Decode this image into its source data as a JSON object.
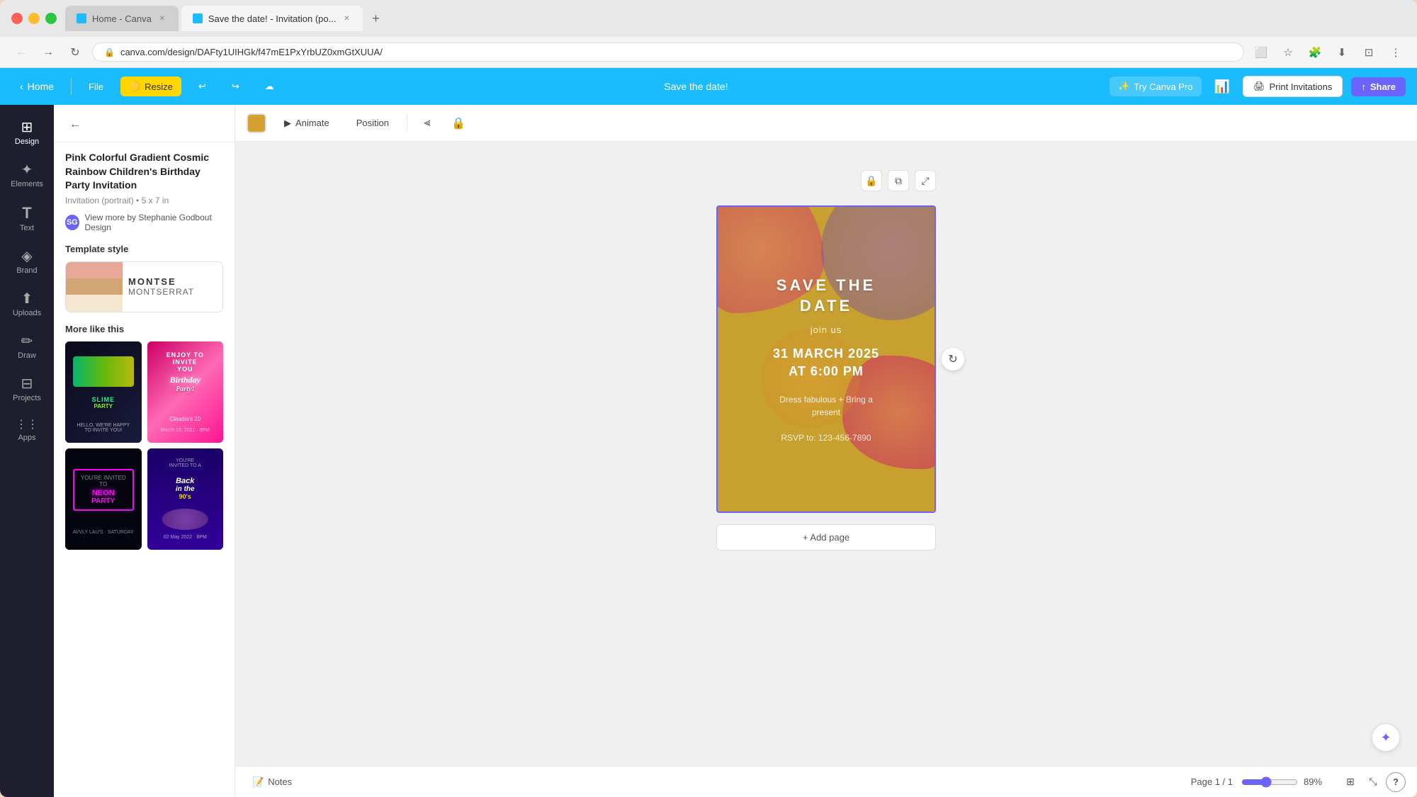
{
  "browser": {
    "tabs": [
      {
        "id": "home",
        "label": "Home - Canva",
        "active": false,
        "favicon": "C"
      },
      {
        "id": "design",
        "label": "Save the date! - Invitation (po...",
        "active": true,
        "favicon": "C"
      }
    ],
    "address": "canva.com/design/DAFty1UIHGk/f47mE1PxYrbUZ0xmGtXUUA/",
    "new_tab_label": "+"
  },
  "topbar": {
    "home_label": "Home",
    "file_label": "File",
    "resize_label": "Resize",
    "undo_icon": "↩",
    "redo_icon": "↪",
    "cloud_icon": "☁",
    "title": "Save the date!",
    "try_pro_label": "Try Canva Pro",
    "analytics_icon": "📊",
    "print_label": "Print Invitations",
    "share_label": "Share"
  },
  "icon_nav": {
    "items": [
      {
        "id": "design",
        "icon": "⊞",
        "label": "Design",
        "active": true
      },
      {
        "id": "elements",
        "icon": "✦",
        "label": "Elements"
      },
      {
        "id": "text",
        "icon": "T",
        "label": "Text"
      },
      {
        "id": "brand",
        "icon": "◈",
        "label": "Brand"
      },
      {
        "id": "uploads",
        "icon": "⬆",
        "label": "Uploads"
      },
      {
        "id": "draw",
        "icon": "✏",
        "label": "Draw"
      },
      {
        "id": "projects",
        "icon": "⊟",
        "label": "Projects"
      },
      {
        "id": "apps",
        "icon": "⋮⋮",
        "label": "Apps"
      }
    ]
  },
  "panel": {
    "back_icon": "←",
    "template_title": "Pink Colorful Gradient Cosmic Rainbow Children's Birthday Party Invitation",
    "template_meta": "Invitation (portrait) • 5 x 7 in",
    "author_initials": "SG",
    "author_link": "View more by Stephanie Godbout Design",
    "template_style_label": "Template style",
    "font_name_1": "MONTSE",
    "font_name_2": "MONTSERRAT",
    "more_like_this_label": "More like this",
    "templates": [
      {
        "id": "slime",
        "label": "SLIME\nPARTY",
        "class": "thumb-slime"
      },
      {
        "id": "birthday",
        "label": "Birthday\nParty!",
        "class": "thumb-birthday"
      },
      {
        "id": "neon",
        "label": "NEON\nPARTY",
        "class": "thumb-neon"
      },
      {
        "id": "90s",
        "label": "Back\nin the\n90's",
        "class": "thumb-90s"
      }
    ]
  },
  "toolbar": {
    "animate_label": "Animate",
    "position_label": "Position",
    "filter_icon": "⫶",
    "lock_icon": "🔒"
  },
  "canvas": {
    "card": {
      "title": "SAVE THE\nDATE",
      "join_text": "join us",
      "date": "31 MARCH 2025",
      "time": "AT 6:00 PM",
      "dress_code": "Dress fabulous + Bring a\npresent",
      "rsvp": "RSVP to: 123-456-7890"
    },
    "add_page_label": "+ Add page"
  },
  "bottom": {
    "notes_label": "Notes",
    "notes_icon": "📝",
    "page_indicator": "Page 1 / 1",
    "zoom_level": 89,
    "zoom_label": "89%",
    "expand_icon": "⤢",
    "help_icon": "?",
    "grid_icon": "⊞",
    "fullscreen_icon": "⤡"
  },
  "colors": {
    "primary": "#1abcfe",
    "sidebar_bg": "#1e1e2e",
    "accent_purple": "#6c63ff",
    "card_bg": "#c8a030",
    "pro_yellow": "#ffd700"
  }
}
